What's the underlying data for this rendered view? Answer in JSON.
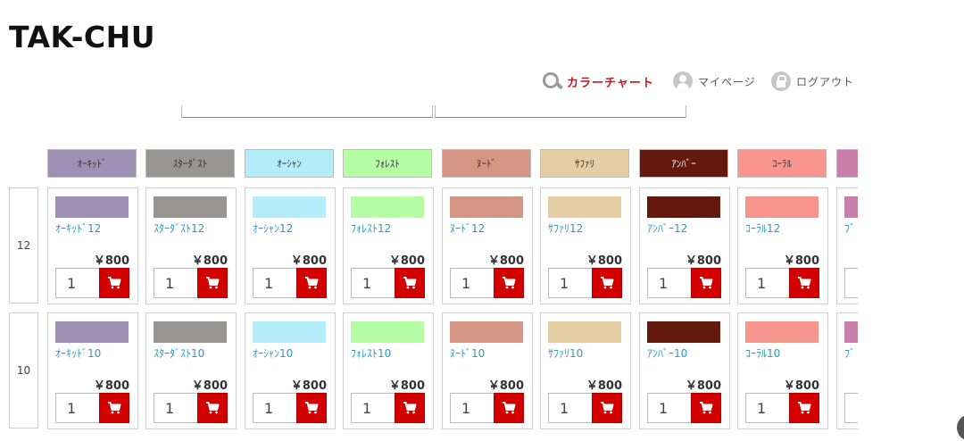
{
  "site": {
    "logo": "TAK-CHU"
  },
  "nav": {
    "color_chart": "カラーチャート",
    "mypage": "マイページ",
    "logout": "ログアウト"
  },
  "colors": [
    {
      "name": "ｵｰｷｯﾄﾞ",
      "hex": "#a08fb5",
      "header_text": "#333333"
    },
    {
      "name": "ｽﾀｰﾀﾞｽﾄ",
      "hex": "#9a9595",
      "header_text": "#333333"
    },
    {
      "name": "ｵｰｼｬﾝ",
      "hex": "#b4ecfb",
      "header_text": "#333333"
    },
    {
      "name": "ﾌｫﾚｽﾄ",
      "hex": "#b6fca5",
      "header_text": "#333333"
    },
    {
      "name": "ﾇｰﾄﾞ",
      "hex": "#d59585",
      "header_text": "#333333"
    },
    {
      "name": "ｻﾌｧﾘ",
      "hex": "#e6cea4",
      "header_text": "#333333"
    },
    {
      "name": "ｱﾝﾊﾞｰ",
      "hex": "#64190c",
      "header_text": "#ffffff"
    },
    {
      "name": "ｺｰﾗﾙ",
      "hex": "#f8958e",
      "header_text": "#333333"
    },
    {
      "name": "",
      "hex": "#c97fab",
      "header_text": "#333333"
    }
  ],
  "rows": [
    {
      "label": "12",
      "products": [
        {
          "name": "ｵｰｷｯﾄﾞ12",
          "price": "￥800",
          "qty": "1"
        },
        {
          "name": "ｽﾀｰﾀﾞｽﾄ12",
          "price": "￥800",
          "qty": "1"
        },
        {
          "name": "ｵｰｼｬﾝ12",
          "price": "￥800",
          "qty": "1"
        },
        {
          "name": "ﾌｫﾚｽﾄ12",
          "price": "￥800",
          "qty": "1"
        },
        {
          "name": "ﾇｰﾄﾞ12",
          "price": "￥800",
          "qty": "1"
        },
        {
          "name": "ｻﾌｧﾘ12",
          "price": "￥800",
          "qty": "1"
        },
        {
          "name": "ｱﾝﾊﾞｰ12",
          "price": "￥800",
          "qty": "1"
        },
        {
          "name": "ｺｰﾗﾙ12",
          "price": "￥800",
          "qty": "1"
        },
        {
          "name": "ﾌﾞ",
          "price": "",
          "qty": ""
        }
      ]
    },
    {
      "label": "10",
      "products": [
        {
          "name": "ｵｰｷｯﾄﾞ10",
          "price": "￥800",
          "qty": "1"
        },
        {
          "name": "ｽﾀｰﾀﾞｽﾄ10",
          "price": "￥800",
          "qty": "1"
        },
        {
          "name": "ｵｰｼｬﾝ10",
          "price": "￥800",
          "qty": "1"
        },
        {
          "name": "ﾌｫﾚｽﾄ10",
          "price": "￥800",
          "qty": "1"
        },
        {
          "name": "ﾇｰﾄﾞ10",
          "price": "￥800",
          "qty": "1"
        },
        {
          "name": "ｻﾌｧﾘ10",
          "price": "￥800",
          "qty": "1"
        },
        {
          "name": "ｱﾝﾊﾞｰ10",
          "price": "￥800",
          "qty": "1"
        },
        {
          "name": "ｺｰﾗﾙ10",
          "price": "￥800",
          "qty": "1"
        },
        {
          "name": "ﾌﾞ",
          "price": "",
          "qty": ""
        }
      ]
    }
  ],
  "icons": {
    "search": "search-icon",
    "user": "user-icon",
    "lock": "lock-icon",
    "cart": "cart-icon"
  },
  "accent_color": "#d30000"
}
